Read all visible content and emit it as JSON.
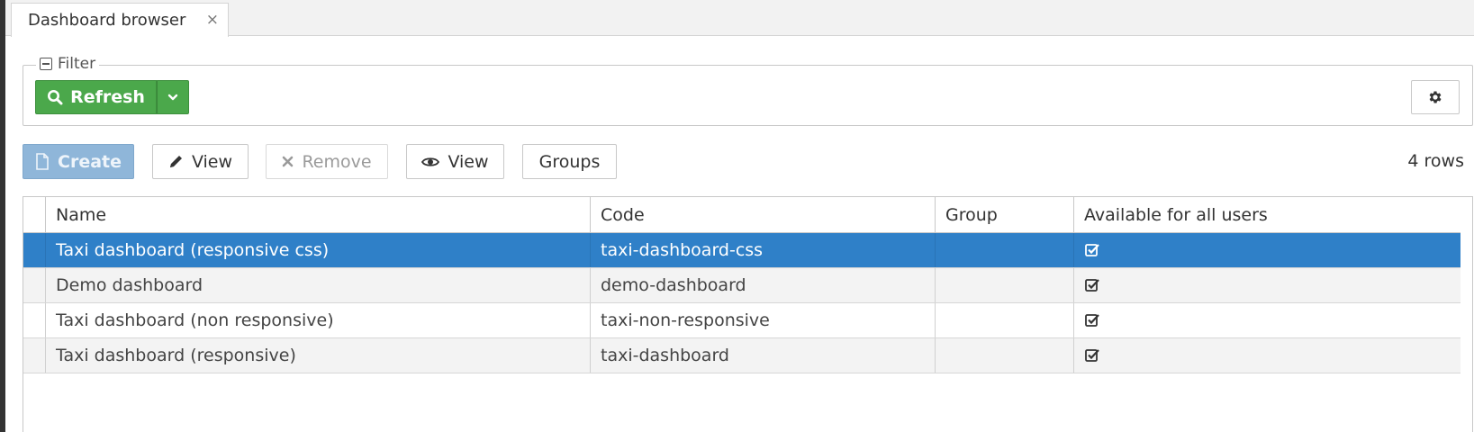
{
  "tabs": [
    {
      "label": "Dashboard browser",
      "close": "×"
    }
  ],
  "filter": {
    "legend": "Filter",
    "refresh_label": "Refresh"
  },
  "toolbar": {
    "create_label": "Create",
    "edit_view_label": "View",
    "remove_label": "Remove",
    "view_label": "View",
    "groups_label": "Groups",
    "rows_count": "4 rows"
  },
  "table": {
    "columns": [
      "Name",
      "Code",
      "Group",
      "Available for all users"
    ],
    "rows": [
      {
        "name": "Taxi dashboard (responsive css)",
        "code": "taxi-dashboard-css",
        "group": "",
        "available": true
      },
      {
        "name": "Demo dashboard",
        "code": "demo-dashboard",
        "group": "",
        "available": true
      },
      {
        "name": "Taxi dashboard (non responsive)",
        "code": "taxi-non-responsive",
        "group": "",
        "available": true
      },
      {
        "name": "Taxi dashboard (responsive)",
        "code": "taxi-dashboard",
        "group": "",
        "available": true
      }
    ],
    "selected_row": 0
  },
  "colors": {
    "accent_green": "#4ba84b",
    "selected_row": "#2f80c8",
    "create_disabled": "#8fb6d9"
  }
}
